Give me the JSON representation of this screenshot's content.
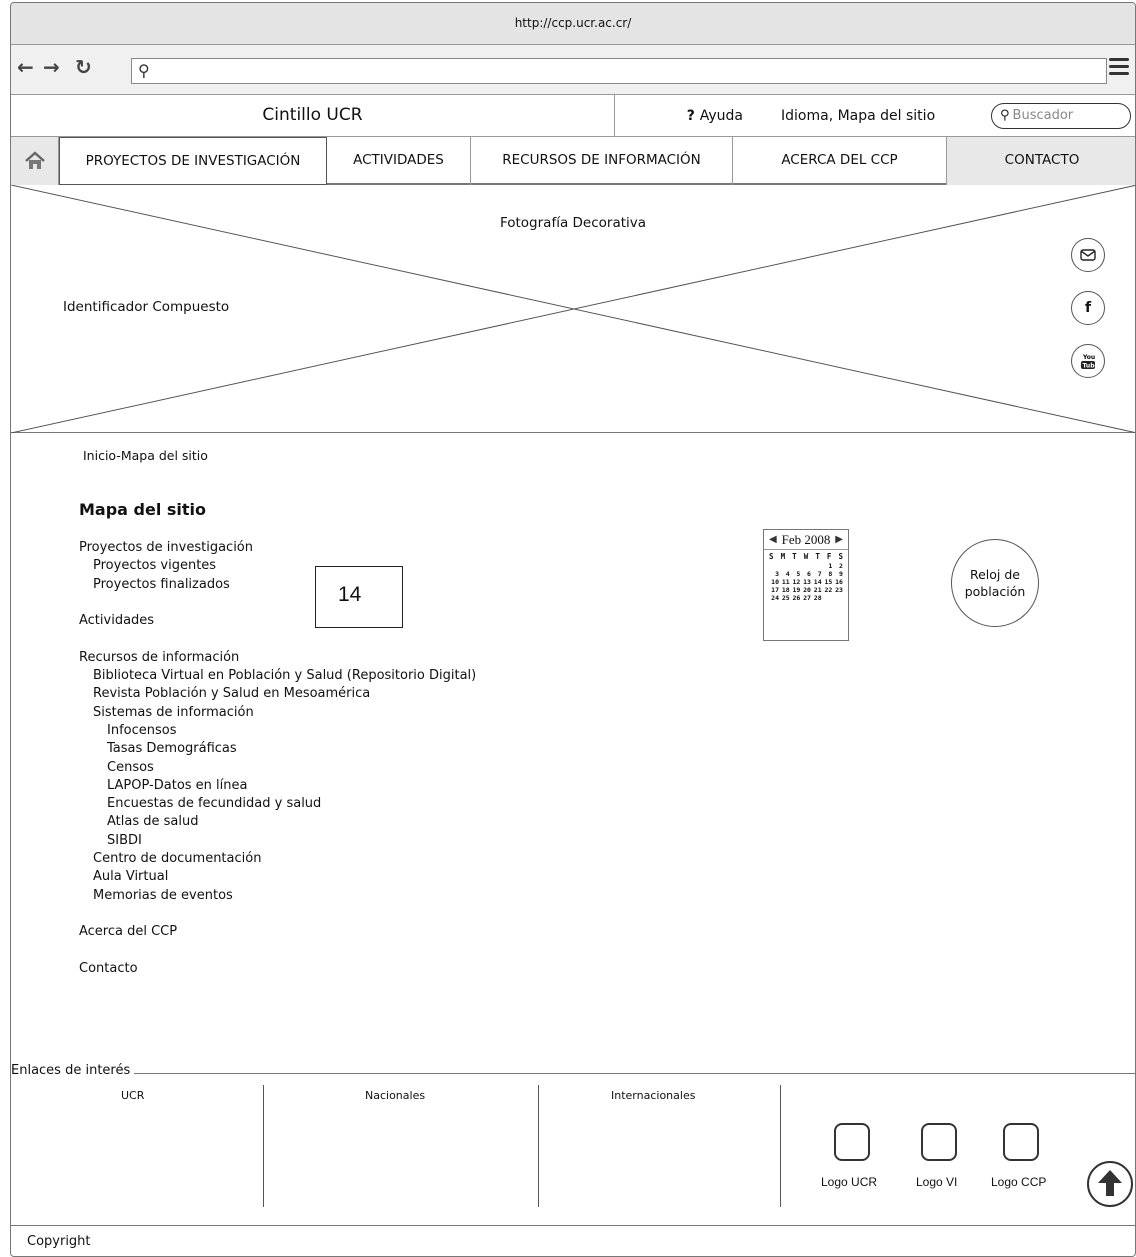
{
  "browser": {
    "url": "http://ccp.ucr.ac.cr/"
  },
  "header": {
    "cintillo": "Cintillo UCR",
    "ayuda": "Ayuda",
    "idioma": "Idioma, Mapa del sitio",
    "search_placeholder": "Buscador"
  },
  "nav": {
    "items": [
      {
        "label": "PROYECTOS DE INVESTIGACIÓN"
      },
      {
        "label": "ACTIVIDADES"
      },
      {
        "label": "RECURSOS DE INFORMACIÓN"
      },
      {
        "label": "ACERCA DEL CCP"
      },
      {
        "label": "CONTACTO"
      }
    ]
  },
  "hero": {
    "caption": "Fotografía Decorativa",
    "identifier": "Identificador Compuesto",
    "social": [
      "mail-icon",
      "facebook-icon",
      "youtube-icon"
    ]
  },
  "breadcrumb": "Inicio-Mapa del sitio",
  "sitemap": {
    "title": "Mapa del sitio",
    "items": [
      "Proyectos de investigación",
      "Proyectos vigentes",
      "Proyectos finalizados",
      "Actividades",
      "Recursos de información",
      "Biblioteca Virtual en Población y Salud (Repositorio Digital)",
      "Revista Población y Salud en Mesoamérica",
      "Sistemas de información",
      "Infocensos",
      "Tasas Demográficas",
      "Censos",
      "LAPOP-Datos en línea",
      "Encuestas de fecundidad y salud",
      "Atlas de salud",
      "SIBDI",
      "Centro de documentación",
      "Aula Virtual",
      "Memorias de eventos",
      "Acerca del CCP",
      "Contacto"
    ]
  },
  "annotation": "14",
  "calendar": {
    "month": "Feb 2008",
    "days_of_week": [
      "S",
      "M",
      "T",
      "W",
      "T",
      "F",
      "S"
    ],
    "weeks": [
      [
        "",
        "",
        "",
        "",
        "",
        "1",
        "2"
      ],
      [
        "3",
        "4",
        "5",
        "6",
        "7",
        "8",
        "9"
      ],
      [
        "10",
        "11",
        "12",
        "13",
        "14",
        "15",
        "16"
      ],
      [
        "17",
        "18",
        "19",
        "20",
        "21",
        "22",
        "23"
      ],
      [
        "24",
        "25",
        "26",
        "27",
        "28",
        "",
        ""
      ]
    ]
  },
  "reloj": {
    "line1": "Reloj de",
    "line2": "población"
  },
  "links": {
    "legend": "Enlaces de interés",
    "columns": [
      "UCR",
      "Nacionales",
      "Internacionales"
    ],
    "logos": [
      "Logo UCR",
      "Logo VI",
      "Logo CCP"
    ]
  },
  "footer": {
    "copyright": "Copyright"
  }
}
